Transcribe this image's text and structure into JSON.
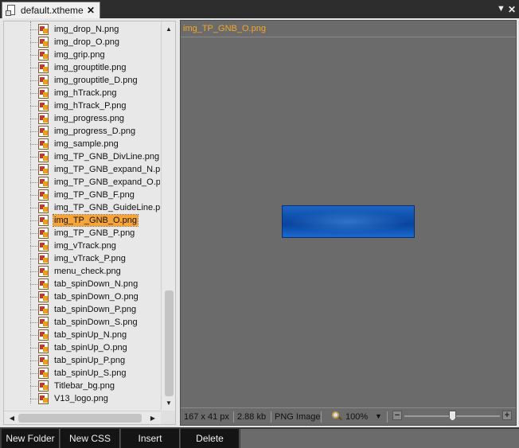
{
  "window": {
    "tab_title": "default.xtheme",
    "tab_close": "✕",
    "dropdown_glyph": "▼",
    "close_glyph": "✕"
  },
  "tree": {
    "items": [
      {
        "label": "img_drop_N.png",
        "selected": false
      },
      {
        "label": "img_drop_O.png",
        "selected": false
      },
      {
        "label": "img_grip.png",
        "selected": false
      },
      {
        "label": "img_grouptitle.png",
        "selected": false
      },
      {
        "label": "img_grouptitle_D.png",
        "selected": false
      },
      {
        "label": "img_hTrack.png",
        "selected": false
      },
      {
        "label": "img_hTrack_P.png",
        "selected": false
      },
      {
        "label": "img_progress.png",
        "selected": false
      },
      {
        "label": "img_progress_D.png",
        "selected": false
      },
      {
        "label": "img_sample.png",
        "selected": false
      },
      {
        "label": "img_TP_GNB_DivLine.png",
        "selected": false
      },
      {
        "label": "img_TP_GNB_expand_N.png",
        "selected": false
      },
      {
        "label": "img_TP_GNB_expand_O.png",
        "selected": false
      },
      {
        "label": "img_TP_GNB_F.png",
        "selected": false
      },
      {
        "label": "img_TP_GNB_GuideLine.png",
        "selected": false
      },
      {
        "label": "img_TP_GNB_O.png",
        "selected": true
      },
      {
        "label": "img_TP_GNB_P.png",
        "selected": false
      },
      {
        "label": "img_vTrack.png",
        "selected": false
      },
      {
        "label": "img_vTrack_P.png",
        "selected": false
      },
      {
        "label": "menu_check.png",
        "selected": false
      },
      {
        "label": "tab_spinDown_N.png",
        "selected": false
      },
      {
        "label": "tab_spinDown_O.png",
        "selected": false
      },
      {
        "label": "tab_spinDown_P.png",
        "selected": false
      },
      {
        "label": "tab_spinDown_S.png",
        "selected": false
      },
      {
        "label": "tab_spinUp_N.png",
        "selected": false
      },
      {
        "label": "tab_spinUp_O.png",
        "selected": false
      },
      {
        "label": "tab_spinUp_P.png",
        "selected": false
      },
      {
        "label": "tab_spinUp_S.png",
        "selected": false
      },
      {
        "label": "Titlebar_bg.png",
        "selected": false
      },
      {
        "label": "V13_logo.png",
        "selected": false
      }
    ],
    "scroll": {
      "up": "▲",
      "down": "▼",
      "left": "◀",
      "right": "▶"
    }
  },
  "preview": {
    "title": "img_TP_GNB_O.png",
    "image_colors": {
      "top": "#1d64c4",
      "mid": "#0a45a0",
      "border": "#0a2e6e"
    }
  },
  "status": {
    "dimensions": "167 x 41 px",
    "size": "2.88 kb",
    "type": "PNG Image",
    "zoom": "100%",
    "zoom_dropdown": "▼",
    "zoom_minus": "−",
    "zoom_plus": "+",
    "zoom_level_fraction": 0.5
  },
  "buttons": {
    "new_folder": "New Folder",
    "new_css": "New CSS",
    "insert": "Insert",
    "delete": "Delete"
  },
  "colors": {
    "accent": "#f5a623",
    "selection": "#f7a53a",
    "preview_bg": "#6b6b6b",
    "button_bg": "#141414"
  }
}
